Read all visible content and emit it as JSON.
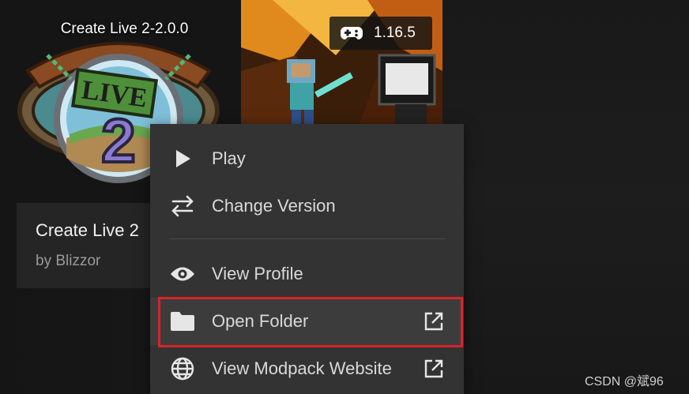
{
  "card": {
    "art_title": "Create Live 2-2.0.0",
    "name": "Create Live 2",
    "author": "by Blizzor"
  },
  "card2": {
    "version": "1.16.5",
    "version_icon": "gamepad-icon"
  },
  "menu": {
    "items": [
      {
        "label": "Play",
        "icon": "play-icon"
      },
      {
        "label": "Change Version",
        "icon": "swap-arrows-icon"
      },
      {
        "label": "View Profile",
        "icon": "eye-icon"
      },
      {
        "label": "Open Folder",
        "icon": "folder-icon",
        "external": true
      },
      {
        "label": "View Modpack Website",
        "icon": "globe-icon",
        "external": true
      }
    ]
  },
  "watermark": "CSDN @斌96",
  "colors": {
    "menu_bg": "#333333",
    "highlight": "#d9232d",
    "text": "#d9d9d9"
  }
}
